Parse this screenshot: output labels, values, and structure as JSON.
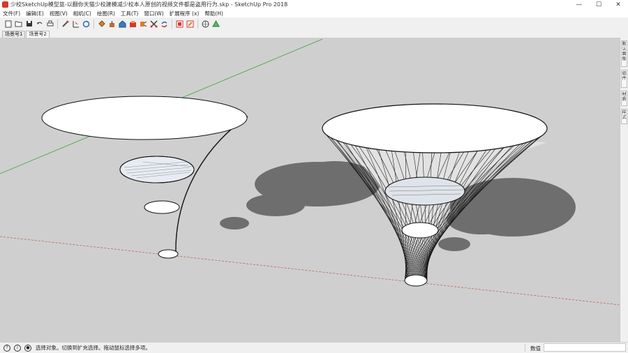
{
  "window": {
    "title": "少校SketchUp模型篮-以翻你天猫少校建模减少校本人原创的视频文件都是盗用行为.skp - SketchUp Pro 2018",
    "minimize": "—",
    "maximize": "☐",
    "close": "✕"
  },
  "menu": {
    "items": [
      "文件(F)",
      "编辑(E)",
      "视图(V)",
      "相机(C)",
      "绘图(R)",
      "工具(T)",
      "窗口(W)",
      "扩展程序 (x)",
      "帮助(H)"
    ]
  },
  "toolbar": {
    "icons": [
      "new-file-icon",
      "open-file-icon",
      "save-icon",
      "undo-icon",
      "print-icon",
      "pencil-icon",
      "dimension-icon",
      "rotate-icon",
      "paint-bucket-icon",
      "push-pull-icon",
      "warehouse-icon",
      "extension-icon",
      "cut-icon",
      "scissors-icon",
      "paste-icon",
      "red-box-icon",
      "orange-box-icon",
      "layers-icon",
      "recycle-icon"
    ]
  },
  "scenes": {
    "tabs": [
      "场景号1",
      "场景号2"
    ],
    "active_index": 1
  },
  "tray": {
    "tabs": [
      "默认面板",
      "组件",
      "材质",
      "样式"
    ]
  },
  "status": {
    "message": "选择对象。切换到扩充选择。拖动鼠标选择多项。",
    "measure_label": "数值",
    "measure_value": ""
  },
  "colors": {
    "viewport_bg": "#cfcfcf",
    "shadow": "#6e6e6e",
    "green_axis": "#3aa53a",
    "red_axis": "#c04040"
  }
}
